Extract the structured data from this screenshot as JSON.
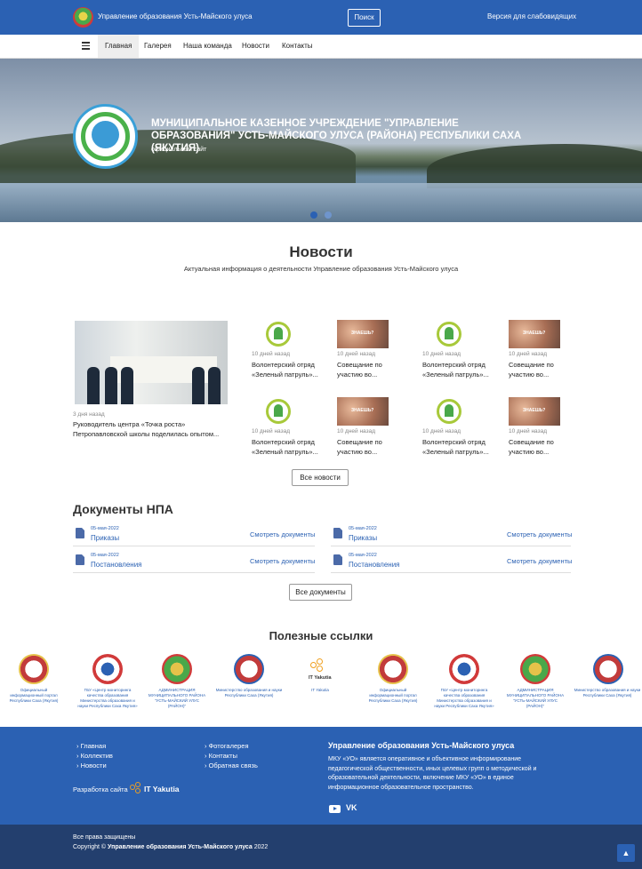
{
  "header": {
    "brand": "Управление образования Усть-Майского улуса",
    "search_label": "Поиск",
    "accessible_label": "Версия для слабовидящих"
  },
  "nav": {
    "items": [
      {
        "label": "Главная"
      },
      {
        "label": "Галерея"
      },
      {
        "label": "Наша команда"
      },
      {
        "label": "Новости"
      },
      {
        "label": "Контакты"
      }
    ]
  },
  "hero": {
    "title": "МУНИЦИПАЛЬНОЕ КАЗЕННОЕ УЧРЕЖДЕНИЕ \"УПРАВЛЕНИЕ ОБРАЗОВАНИЯ\" УСТЬ-МАЙСКОГО УЛУСА (РАЙОНА) РЕСПУБЛИКИ САХА (ЯКУТИЯ)",
    "subtitle": "официальный сайт"
  },
  "news": {
    "heading": "Новости",
    "subheading": "Актуальная информация о деятельности Управление образования Усть-Майского улуса",
    "featured": {
      "date": "3 дня назад",
      "title": "Руководитель центра «Точка роста» Петропавловской школы поделилась опытом..."
    },
    "items": [
      {
        "date": "10 дней назад",
        "title": "Волонтерский отряд «Зеленый патруль»..."
      },
      {
        "date": "10 дней назад",
        "title": "Совещание по участию во..."
      },
      {
        "date": "10 дней назад",
        "title": "Волонтерский отряд «Зеленый патруль»..."
      },
      {
        "date": "10 дней назад",
        "title": "Совещание по участию во..."
      },
      {
        "date": "10 дней назад",
        "title": "Волонтерский отряд «Зеленый патруль»..."
      },
      {
        "date": "10 дней назад",
        "title": "Совещание по участию во..."
      },
      {
        "date": "10 дней назад",
        "title": "Волонтерский отряд «Зеленый патруль»..."
      },
      {
        "date": "10 дней назад",
        "title": "Совещание по участию во..."
      }
    ],
    "all_label": "Все новости"
  },
  "docs": {
    "heading": "Документы НПА",
    "items": [
      {
        "date": "05-мая-2022",
        "name": "Приказы",
        "link": "Смотреть документы"
      },
      {
        "date": "05-мая-2022",
        "name": "Приказы",
        "link": "Смотреть документы"
      },
      {
        "date": "05-мая-2022",
        "name": "Постановления",
        "link": "Смотреть документы"
      },
      {
        "date": "05-мая-2022",
        "name": "Постановления",
        "link": "Смотреть документы"
      }
    ],
    "all_label": "Все документы"
  },
  "links": {
    "heading": "Полезные ссылки",
    "items": [
      "Официальный информационный портал Республики Саха (Якутия)",
      "ГБУ «Центр мониторинга качества образования Министерства образования и науки Республики Саха Якутия»",
      "АДМИНИСТРАЦИЯ МУНИЦИПАЛЬНОГО РАЙОНА \"УСТЬ-МАЙСКИЙ УЛУС (РАЙОН)\"",
      "Министерство образования и науки Республики Саха (Якутия)",
      "IT Yakutia",
      "Официальный информационный портал Республики Саха (Якутия)",
      "ГБУ «Центр мониторинга качества образования Министерства образования и науки Республики Саха Якутия»",
      "АДМИНИСТРАЦИЯ МУНИЦИПАЛЬНОГО РАЙОНА \"УСТЬ-МАЙСКИЙ УЛУС (РАЙОН)\"",
      "Министерство образования и науки Республики Саха (Якутия)"
    ],
    "it_logo_text": "IT Yakutia"
  },
  "footer": {
    "col1": [
      "Главная",
      "Коллектив",
      "Новости"
    ],
    "col2": [
      "Фотогалерея",
      "Контакты",
      "Обратная связь"
    ],
    "heading": "Управление образования Усть-Майского улуса",
    "description": "МКУ «УО» является оперативное и объективное информирование педагогической общественности, иных целевых групп о методической и образовательной деятельности, включение МКУ «УО» в единое информационное образовательное пространство.",
    "dev_label": "Разработка сайта",
    "dev_name": "IT Yakutia",
    "vk": "VK",
    "rights": "Все права защищены",
    "copyright_prefix": "Copyright ©",
    "copyright_name": "Управление образования Усть-Майского улуса",
    "year": "2022"
  },
  "colors": {
    "primary": "#2b61b3",
    "dark": "#233f6e"
  }
}
